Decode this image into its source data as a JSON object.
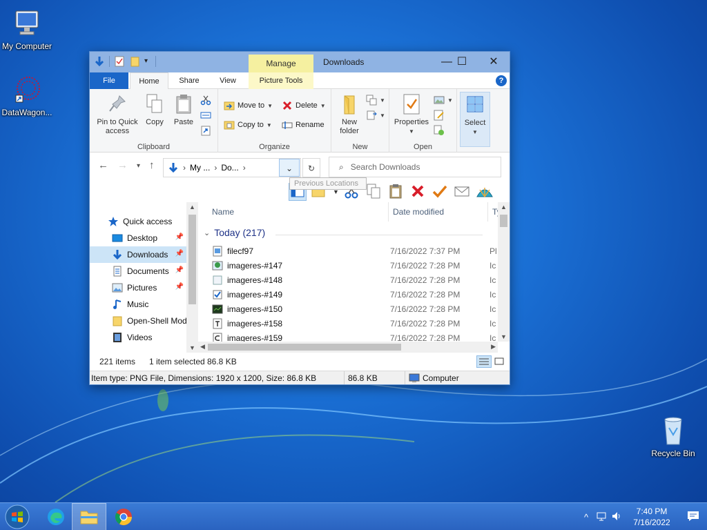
{
  "desktop": {
    "icons": [
      {
        "label": "My Computer"
      },
      {
        "label": "DataWagon..."
      },
      {
        "label": "Recycle Bin"
      }
    ]
  },
  "window": {
    "title": "Downloads",
    "manage_label": "Manage",
    "controls": {
      "minimize": "—",
      "maximize": "☐",
      "close": "✕"
    },
    "tabs": {
      "file": "File",
      "home": "Home",
      "share": "Share",
      "view": "View",
      "picture_tools": "Picture Tools"
    },
    "help": "?",
    "ribbon": {
      "clipboard": {
        "label": "Clipboard",
        "pin_line1": "Pin to Quick",
        "pin_line2": "access",
        "copy": "Copy",
        "paste": "Paste"
      },
      "organize": {
        "label": "Organize",
        "move_to": "Move to",
        "copy_to": "Copy to",
        "delete": "Delete",
        "rename": "Rename"
      },
      "new": {
        "label": "New",
        "new_folder_line1": "New",
        "new_folder_line2": "folder"
      },
      "open": {
        "label": "Open",
        "properties": "Properties"
      },
      "select": {
        "label": "Select"
      }
    },
    "address": {
      "crumb1": "My ...",
      "crumb2": "Do...",
      "tooltip": "Previous Locations",
      "search_placeholder": "Search Downloads"
    },
    "nav": {
      "quick_access": "Quick access",
      "items": [
        {
          "label": "Desktop"
        },
        {
          "label": "Downloads"
        },
        {
          "label": "Documents"
        },
        {
          "label": "Pictures"
        },
        {
          "label": "Music"
        },
        {
          "label": "Open-Shell Mod"
        },
        {
          "label": "Videos"
        }
      ]
    },
    "columns": {
      "name": "Name",
      "date": "Date modified",
      "type": "Ty"
    },
    "group": {
      "label": "Today (217)"
    },
    "files": [
      {
        "name": "filecf97",
        "date": "7/16/2022 7:37 PM",
        "type": "Pl"
      },
      {
        "name": "imageres-#147",
        "date": "7/16/2022 7:28 PM",
        "type": "Ic"
      },
      {
        "name": "imageres-#148",
        "date": "7/16/2022 7:28 PM",
        "type": "Ic"
      },
      {
        "name": "imageres-#149",
        "date": "7/16/2022 7:28 PM",
        "type": "Ic"
      },
      {
        "name": "imageres-#150",
        "date": "7/16/2022 7:28 PM",
        "type": "Ic"
      },
      {
        "name": "imageres-#158",
        "date": "7/16/2022 7:28 PM",
        "type": "Ic"
      },
      {
        "name": "imageres-#159",
        "date": "7/16/2022 7:28 PM",
        "type": "Ic"
      }
    ],
    "status": {
      "count": "221 items",
      "selected": "1 item selected",
      "size": "86.8 KB"
    },
    "details_bar": {
      "item_type": "Item type: PNG File, Dimensions: 1920 x 1200, Size: 86.8 KB",
      "size": "86.8 KB",
      "location": "Computer"
    }
  },
  "taskbar": {
    "time": "7:40 PM",
    "date": "7/16/2022"
  }
}
